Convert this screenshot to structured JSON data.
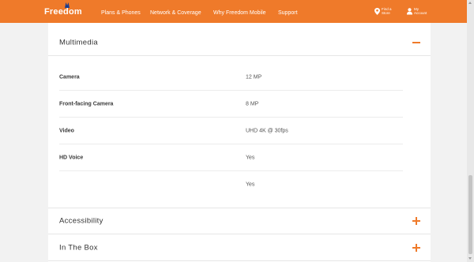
{
  "colors": {
    "brand": "#ef7a2a",
    "background": "#f2f2f2",
    "panel": "#ffffff"
  },
  "header": {
    "logo": "Freedom",
    "nav": [
      "Plans & Phones",
      "Network & Coverage",
      "Why Freedom Mobile",
      "Support"
    ],
    "find_store_line1": "Find a",
    "find_store_line2": "Store",
    "account_line1": "My",
    "account_line2": "Account"
  },
  "sections": {
    "multimedia": {
      "title": "Multimedia",
      "state": "expanded",
      "rows": [
        {
          "label": "Camera",
          "value": "12 MP"
        },
        {
          "label": "Front-facing Camera",
          "value": "8 MP"
        },
        {
          "label": "Video",
          "value": "UHD 4K @ 30fps"
        },
        {
          "label": "HD Voice",
          "value": "Yes"
        },
        {
          "label": "",
          "value": "Yes"
        }
      ]
    },
    "accessibility": {
      "title": "Accessibility",
      "state": "collapsed"
    },
    "in_the_box": {
      "title": "In The Box",
      "state": "collapsed"
    }
  }
}
